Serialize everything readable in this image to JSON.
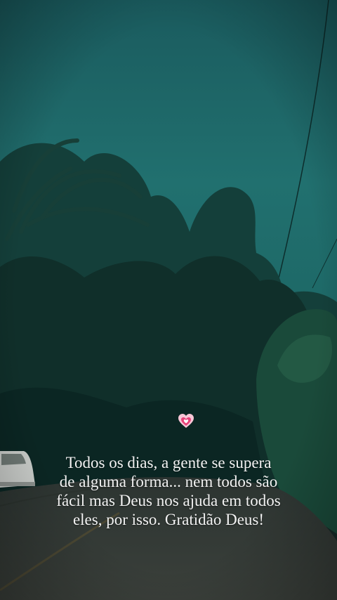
{
  "story": {
    "sticker": "growing-heart-icon",
    "caption_lines": [
      "Todos os dias, a gente se supera",
      "de alguma forma... nem todos são",
      "fácil mas Deus nos ajuda em todos",
      "eles, por isso. Gratidão Deus!"
    ]
  },
  "colors": {
    "sky": "#1f6a6b",
    "foliage": "#0f2e29",
    "road": "#3a3f3a",
    "text": "#f2f2f2",
    "heart": "#e8437a"
  }
}
